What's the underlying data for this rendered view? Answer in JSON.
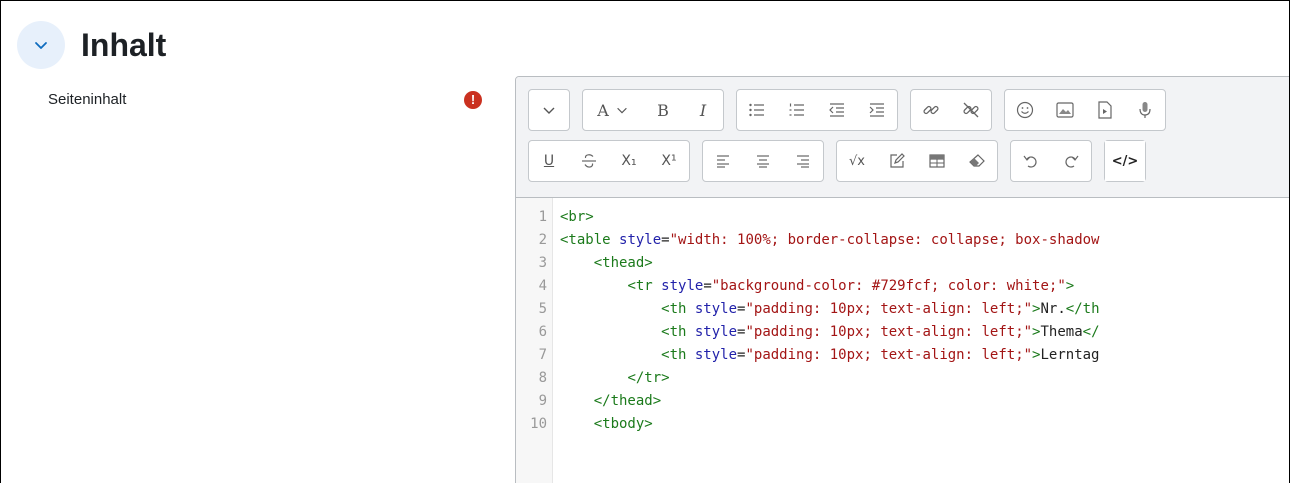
{
  "section": {
    "title": "Inhalt"
  },
  "field": {
    "label": "Seiteninhalt",
    "required_symbol": "!"
  },
  "editor": {
    "toolbar_row1": [
      [
        "chevron-down"
      ],
      [
        "font-color-dropdown",
        "bold",
        "italic"
      ],
      [
        "bullet-list",
        "numbered-list",
        "outdent",
        "indent"
      ],
      [
        "link",
        "unlink"
      ],
      [
        "emoji",
        "image",
        "media",
        "microphone"
      ]
    ],
    "toolbar_row2": [
      [
        "underline",
        "strikethrough",
        "subscript",
        "superscript"
      ],
      [
        "align-left",
        "align-center",
        "align-right"
      ],
      [
        "equation",
        "edit",
        "table",
        "clear-formatting"
      ],
      [
        "undo",
        "redo"
      ],
      [
        "source-code"
      ]
    ],
    "toolbar_text": {
      "font": "A",
      "bold": "B",
      "italic": "I",
      "underline": "U",
      "subscript": "X₁",
      "superscript": "X¹",
      "equation": "√x",
      "source": "</>"
    },
    "code_lines": [
      {
        "n": "1",
        "tokens": [
          [
            "tag",
            "<br>"
          ]
        ]
      },
      {
        "n": "2",
        "tokens": [
          [
            "tag",
            "<table "
          ],
          [
            "attr",
            "style"
          ],
          [
            "plain",
            "="
          ],
          [
            "str",
            "\"width: 100%; border-collapse: collapse; box-shadow"
          ]
        ]
      },
      {
        "n": "3",
        "tokens": [
          [
            "plain",
            "    "
          ],
          [
            "tag",
            "<thead>"
          ]
        ]
      },
      {
        "n": "4",
        "tokens": [
          [
            "plain",
            "        "
          ],
          [
            "tag",
            "<tr "
          ],
          [
            "attr",
            "style"
          ],
          [
            "plain",
            "="
          ],
          [
            "str",
            "\"background-color: #729fcf; color: white;\""
          ],
          [
            "tag",
            ">"
          ]
        ]
      },
      {
        "n": "5",
        "tokens": [
          [
            "plain",
            "            "
          ],
          [
            "tag",
            "<th "
          ],
          [
            "attr",
            "style"
          ],
          [
            "plain",
            "="
          ],
          [
            "str",
            "\"padding: 10px; text-align: left;\""
          ],
          [
            "tag",
            ">"
          ],
          [
            "plain",
            "Nr."
          ],
          [
            "tag",
            "</th"
          ]
        ]
      },
      {
        "n": "6",
        "tokens": [
          [
            "plain",
            "            "
          ],
          [
            "tag",
            "<th "
          ],
          [
            "attr",
            "style"
          ],
          [
            "plain",
            "="
          ],
          [
            "str",
            "\"padding: 10px; text-align: left;\""
          ],
          [
            "tag",
            ">"
          ],
          [
            "plain",
            "Thema"
          ],
          [
            "tag",
            "</"
          ]
        ]
      },
      {
        "n": "7",
        "tokens": [
          [
            "plain",
            "            "
          ],
          [
            "tag",
            "<th "
          ],
          [
            "attr",
            "style"
          ],
          [
            "plain",
            "="
          ],
          [
            "str",
            "\"padding: 10px; text-align: left;\""
          ],
          [
            "tag",
            ">"
          ],
          [
            "plain",
            "Lerntag"
          ]
        ]
      },
      {
        "n": "8",
        "tokens": [
          [
            "plain",
            "        "
          ],
          [
            "tag",
            "</tr>"
          ]
        ]
      },
      {
        "n": "9",
        "tokens": [
          [
            "plain",
            "    "
          ],
          [
            "tag",
            "</thead>"
          ]
        ]
      },
      {
        "n": "10",
        "tokens": [
          [
            "plain",
            "    "
          ],
          [
            "tag",
            "<tbody>"
          ]
        ]
      }
    ]
  }
}
